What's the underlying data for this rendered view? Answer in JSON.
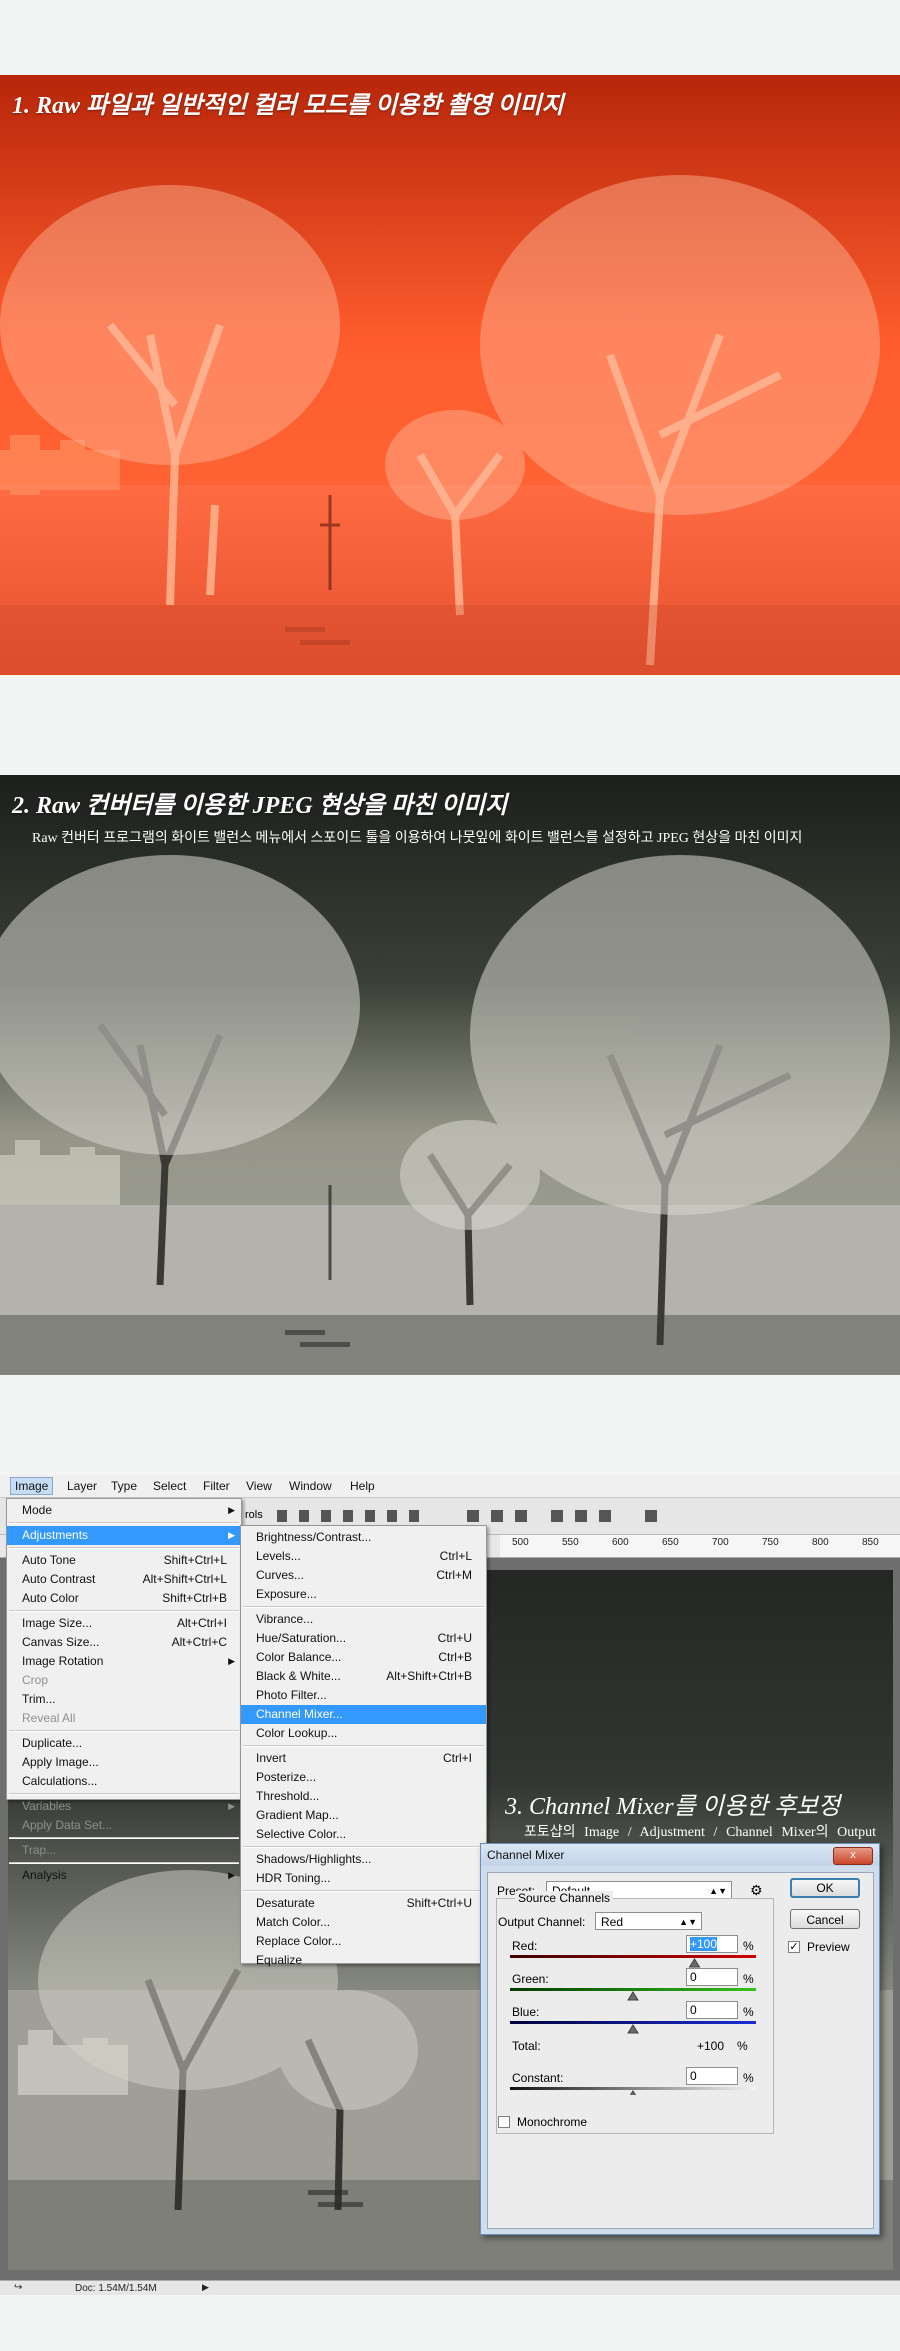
{
  "section1": {
    "title": "1. Raw 파일과 일반적인 컬러 모드를 이용한 촬영 이미지"
  },
  "section2": {
    "title": "2. Raw 컨버터를 이용한 JPEG 현상을 마친 이미지",
    "subtitle": "Raw 컨버터 프로그램의 화이트 밸런스 메뉴에서 스포이드 툴을 이용하여 나뭇잎에 화이트 밸런스를 설정하고 JPEG 현상을 마친 이미지"
  },
  "section3": {
    "title": "3. Channel Mixer를 이용한 후보정",
    "description": "포토샵의 Image / Adjustment / Channel Mixer의 Output Channel에 포함되어 있는 Red와 Blue 영역을 선택하여 간단한 후보정을 진행한다."
  },
  "menubar": {
    "items": [
      "Image",
      "Layer",
      "Type",
      "Select",
      "Filter",
      "View",
      "Window",
      "Help"
    ],
    "options_fragment": "rols"
  },
  "ruler": {
    "ticks": [
      "500",
      "550",
      "600",
      "650",
      "700",
      "750",
      "800",
      "850"
    ]
  },
  "image_menu": [
    {
      "label": "Mode",
      "shortcut": "",
      "submenu": true,
      "state": "normal"
    },
    {
      "sep": true
    },
    {
      "label": "Adjustments",
      "shortcut": "",
      "submenu": true,
      "state": "highlight"
    },
    {
      "sep": true
    },
    {
      "label": "Auto Tone",
      "shortcut": "Shift+Ctrl+L",
      "state": "normal"
    },
    {
      "label": "Auto Contrast",
      "shortcut": "Alt+Shift+Ctrl+L",
      "state": "normal"
    },
    {
      "label": "Auto Color",
      "shortcut": "Shift+Ctrl+B",
      "state": "normal"
    },
    {
      "sep": true
    },
    {
      "label": "Image Size...",
      "shortcut": "Alt+Ctrl+I",
      "state": "normal"
    },
    {
      "label": "Canvas Size...",
      "shortcut": "Alt+Ctrl+C",
      "state": "normal"
    },
    {
      "label": "Image Rotation",
      "shortcut": "",
      "submenu": true,
      "state": "normal"
    },
    {
      "label": "Crop",
      "shortcut": "",
      "state": "disabled"
    },
    {
      "label": "Trim...",
      "shortcut": "",
      "state": "normal"
    },
    {
      "label": "Reveal All",
      "shortcut": "",
      "state": "disabled"
    },
    {
      "sep": true
    },
    {
      "label": "Duplicate...",
      "shortcut": "",
      "state": "normal"
    },
    {
      "label": "Apply Image...",
      "shortcut": "",
      "state": "normal"
    },
    {
      "label": "Calculations...",
      "shortcut": "",
      "state": "normal"
    },
    {
      "sep": true
    },
    {
      "label": "Variables",
      "shortcut": "",
      "submenu": true,
      "state": "disabled"
    },
    {
      "label": "Apply Data Set...",
      "shortcut": "",
      "state": "disabled"
    },
    {
      "sep": true
    },
    {
      "label": "Trap...",
      "shortcut": "",
      "state": "disabled"
    },
    {
      "sep": true
    },
    {
      "label": "Analysis",
      "shortcut": "",
      "submenu": true,
      "state": "normal"
    }
  ],
  "adjust_menu": [
    {
      "label": "Brightness/Contrast...",
      "shortcut": "",
      "state": "normal"
    },
    {
      "label": "Levels...",
      "shortcut": "Ctrl+L",
      "state": "normal"
    },
    {
      "label": "Curves...",
      "shortcut": "Ctrl+M",
      "state": "normal"
    },
    {
      "label": "Exposure...",
      "shortcut": "",
      "state": "normal"
    },
    {
      "sep": true
    },
    {
      "label": "Vibrance...",
      "shortcut": "",
      "state": "normal"
    },
    {
      "label": "Hue/Saturation...",
      "shortcut": "Ctrl+U",
      "state": "normal"
    },
    {
      "label": "Color Balance...",
      "shortcut": "Ctrl+B",
      "state": "normal"
    },
    {
      "label": "Black & White...",
      "shortcut": "Alt+Shift+Ctrl+B",
      "state": "normal"
    },
    {
      "label": "Photo Filter...",
      "shortcut": "",
      "state": "normal"
    },
    {
      "label": "Channel Mixer...",
      "shortcut": "",
      "state": "highlight"
    },
    {
      "label": "Color Lookup...",
      "shortcut": "",
      "state": "normal"
    },
    {
      "sep": true
    },
    {
      "label": "Invert",
      "shortcut": "Ctrl+I",
      "state": "normal"
    },
    {
      "label": "Posterize...",
      "shortcut": "",
      "state": "normal"
    },
    {
      "label": "Threshold...",
      "shortcut": "",
      "state": "normal"
    },
    {
      "label": "Gradient Map...",
      "shortcut": "",
      "state": "normal"
    },
    {
      "label": "Selective Color...",
      "shortcut": "",
      "state": "normal"
    },
    {
      "sep": true
    },
    {
      "label": "Shadows/Highlights...",
      "shortcut": "",
      "state": "normal"
    },
    {
      "label": "HDR Toning...",
      "shortcut": "",
      "state": "normal"
    },
    {
      "sep": true
    },
    {
      "label": "Desaturate",
      "shortcut": "Shift+Ctrl+U",
      "state": "normal"
    },
    {
      "label": "Match Color...",
      "shortcut": "",
      "state": "normal"
    },
    {
      "label": "Replace Color...",
      "shortcut": "",
      "state": "normal"
    },
    {
      "label": "Equalize",
      "shortcut": "",
      "state": "normal"
    }
  ],
  "dialog": {
    "title": "Channel Mixer",
    "close_label": "x",
    "preset_label": "Preset:",
    "preset_value": "Default",
    "output_label": "Output Channel:",
    "output_value": "Red",
    "ok": "OK",
    "cancel": "Cancel",
    "preview": "Preview",
    "preview_checked": true,
    "group_label": "Source Channels",
    "red_label": "Red:",
    "red_value": "+100",
    "green_label": "Green:",
    "green_value": "0",
    "blue_label": "Blue:",
    "blue_value": "0",
    "pct": "%",
    "total_label": "Total:",
    "total_value": "+100",
    "constant_label": "Constant:",
    "constant_value": "0",
    "monochrome": "Monochrome",
    "monochrome_checked": false,
    "sliders": {
      "red": 1.0,
      "green": 0.0,
      "blue": 0.0,
      "constant": 0.0
    }
  },
  "status": {
    "doc": "Doc: 1.54M/1.54M"
  }
}
